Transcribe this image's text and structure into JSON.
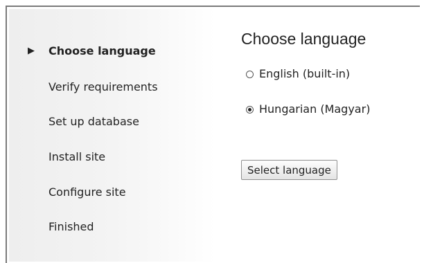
{
  "sidebar": {
    "active_marker": "▶",
    "items": [
      {
        "label": "Choose language",
        "active": true
      },
      {
        "label": "Verify requirements",
        "active": false
      },
      {
        "label": "Set up database",
        "active": false
      },
      {
        "label": "Install site",
        "active": false
      },
      {
        "label": "Configure site",
        "active": false
      },
      {
        "label": "Finished",
        "active": false
      }
    ]
  },
  "main": {
    "title": "Choose language",
    "options": [
      {
        "label": "English (built-in)",
        "selected": false
      },
      {
        "label": "Hungarian (Magyar)",
        "selected": true
      }
    ],
    "submit_label": "Select language"
  },
  "colors": {
    "frame_border": "#7a7a7a",
    "sidebar_gradient_start": "#eeeeee",
    "sidebar_gradient_end": "#ffffff",
    "text": "#222222"
  }
}
